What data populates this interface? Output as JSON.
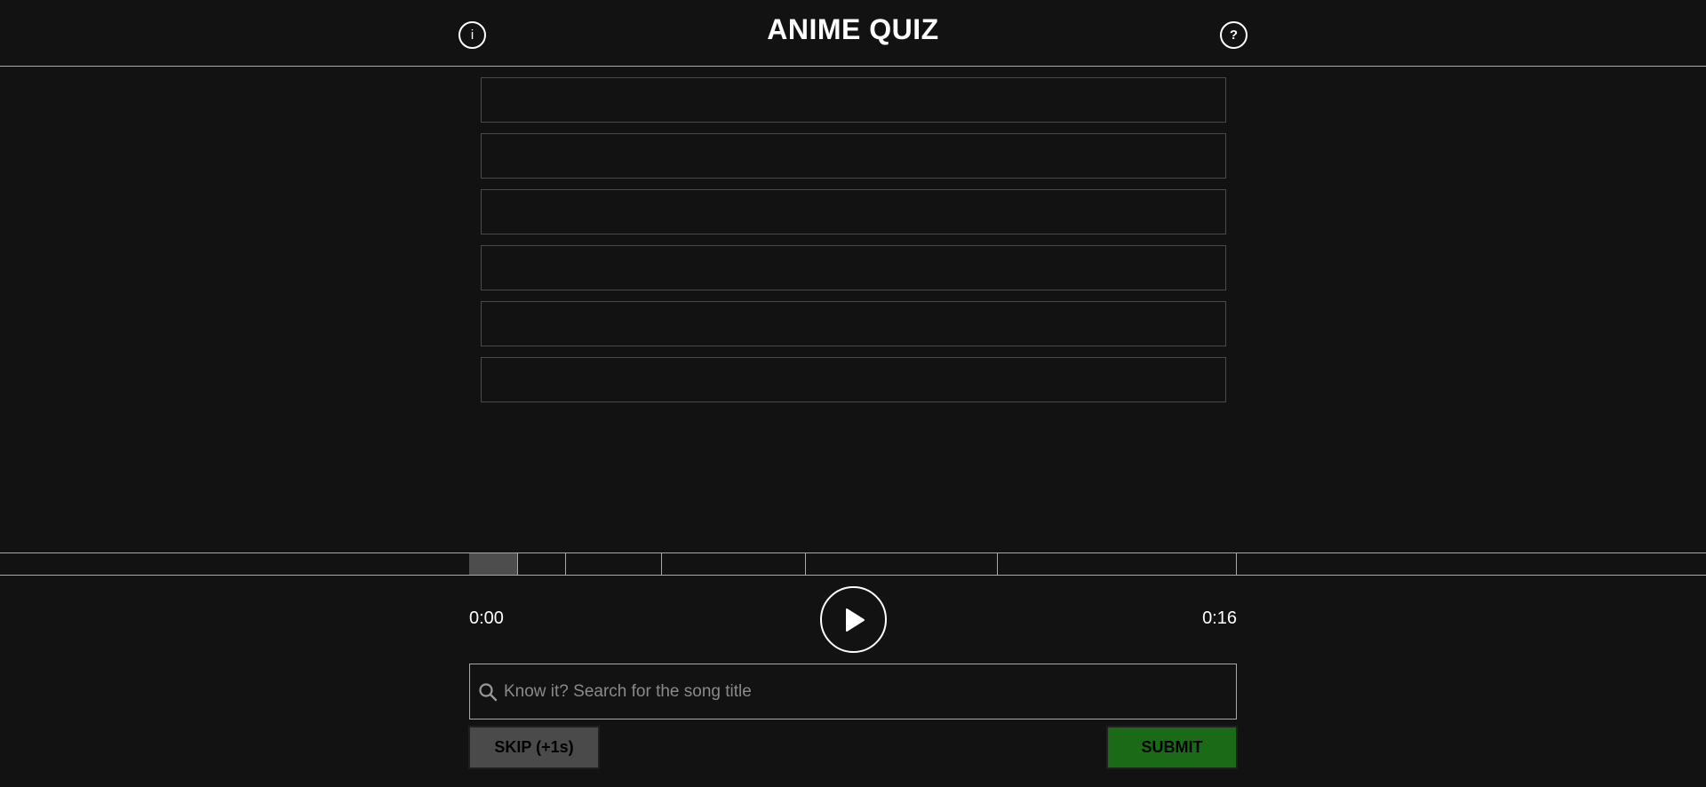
{
  "header": {
    "title": "ANIME QUIZ",
    "info_icon": "i",
    "help_icon": "?"
  },
  "guesses": [
    "",
    "",
    "",
    "",
    "",
    ""
  ],
  "progress": {
    "fill_fraction": 0.0625,
    "segment_boundaries_seconds": [
      1,
      2,
      4,
      7,
      11,
      16
    ],
    "fill_color": "#4d4d4d"
  },
  "player": {
    "current_time": "0:00",
    "total_time": "0:16",
    "play_icon": "play-icon"
  },
  "search": {
    "placeholder": "Know it? Search for the song title",
    "value": ""
  },
  "buttons": {
    "skip_label": "SKIP (+1s)",
    "submit_label": "SUBMIT"
  },
  "colors": {
    "background": "#121212",
    "submit": "#1a6a17",
    "skip": "#4a4a4a"
  }
}
